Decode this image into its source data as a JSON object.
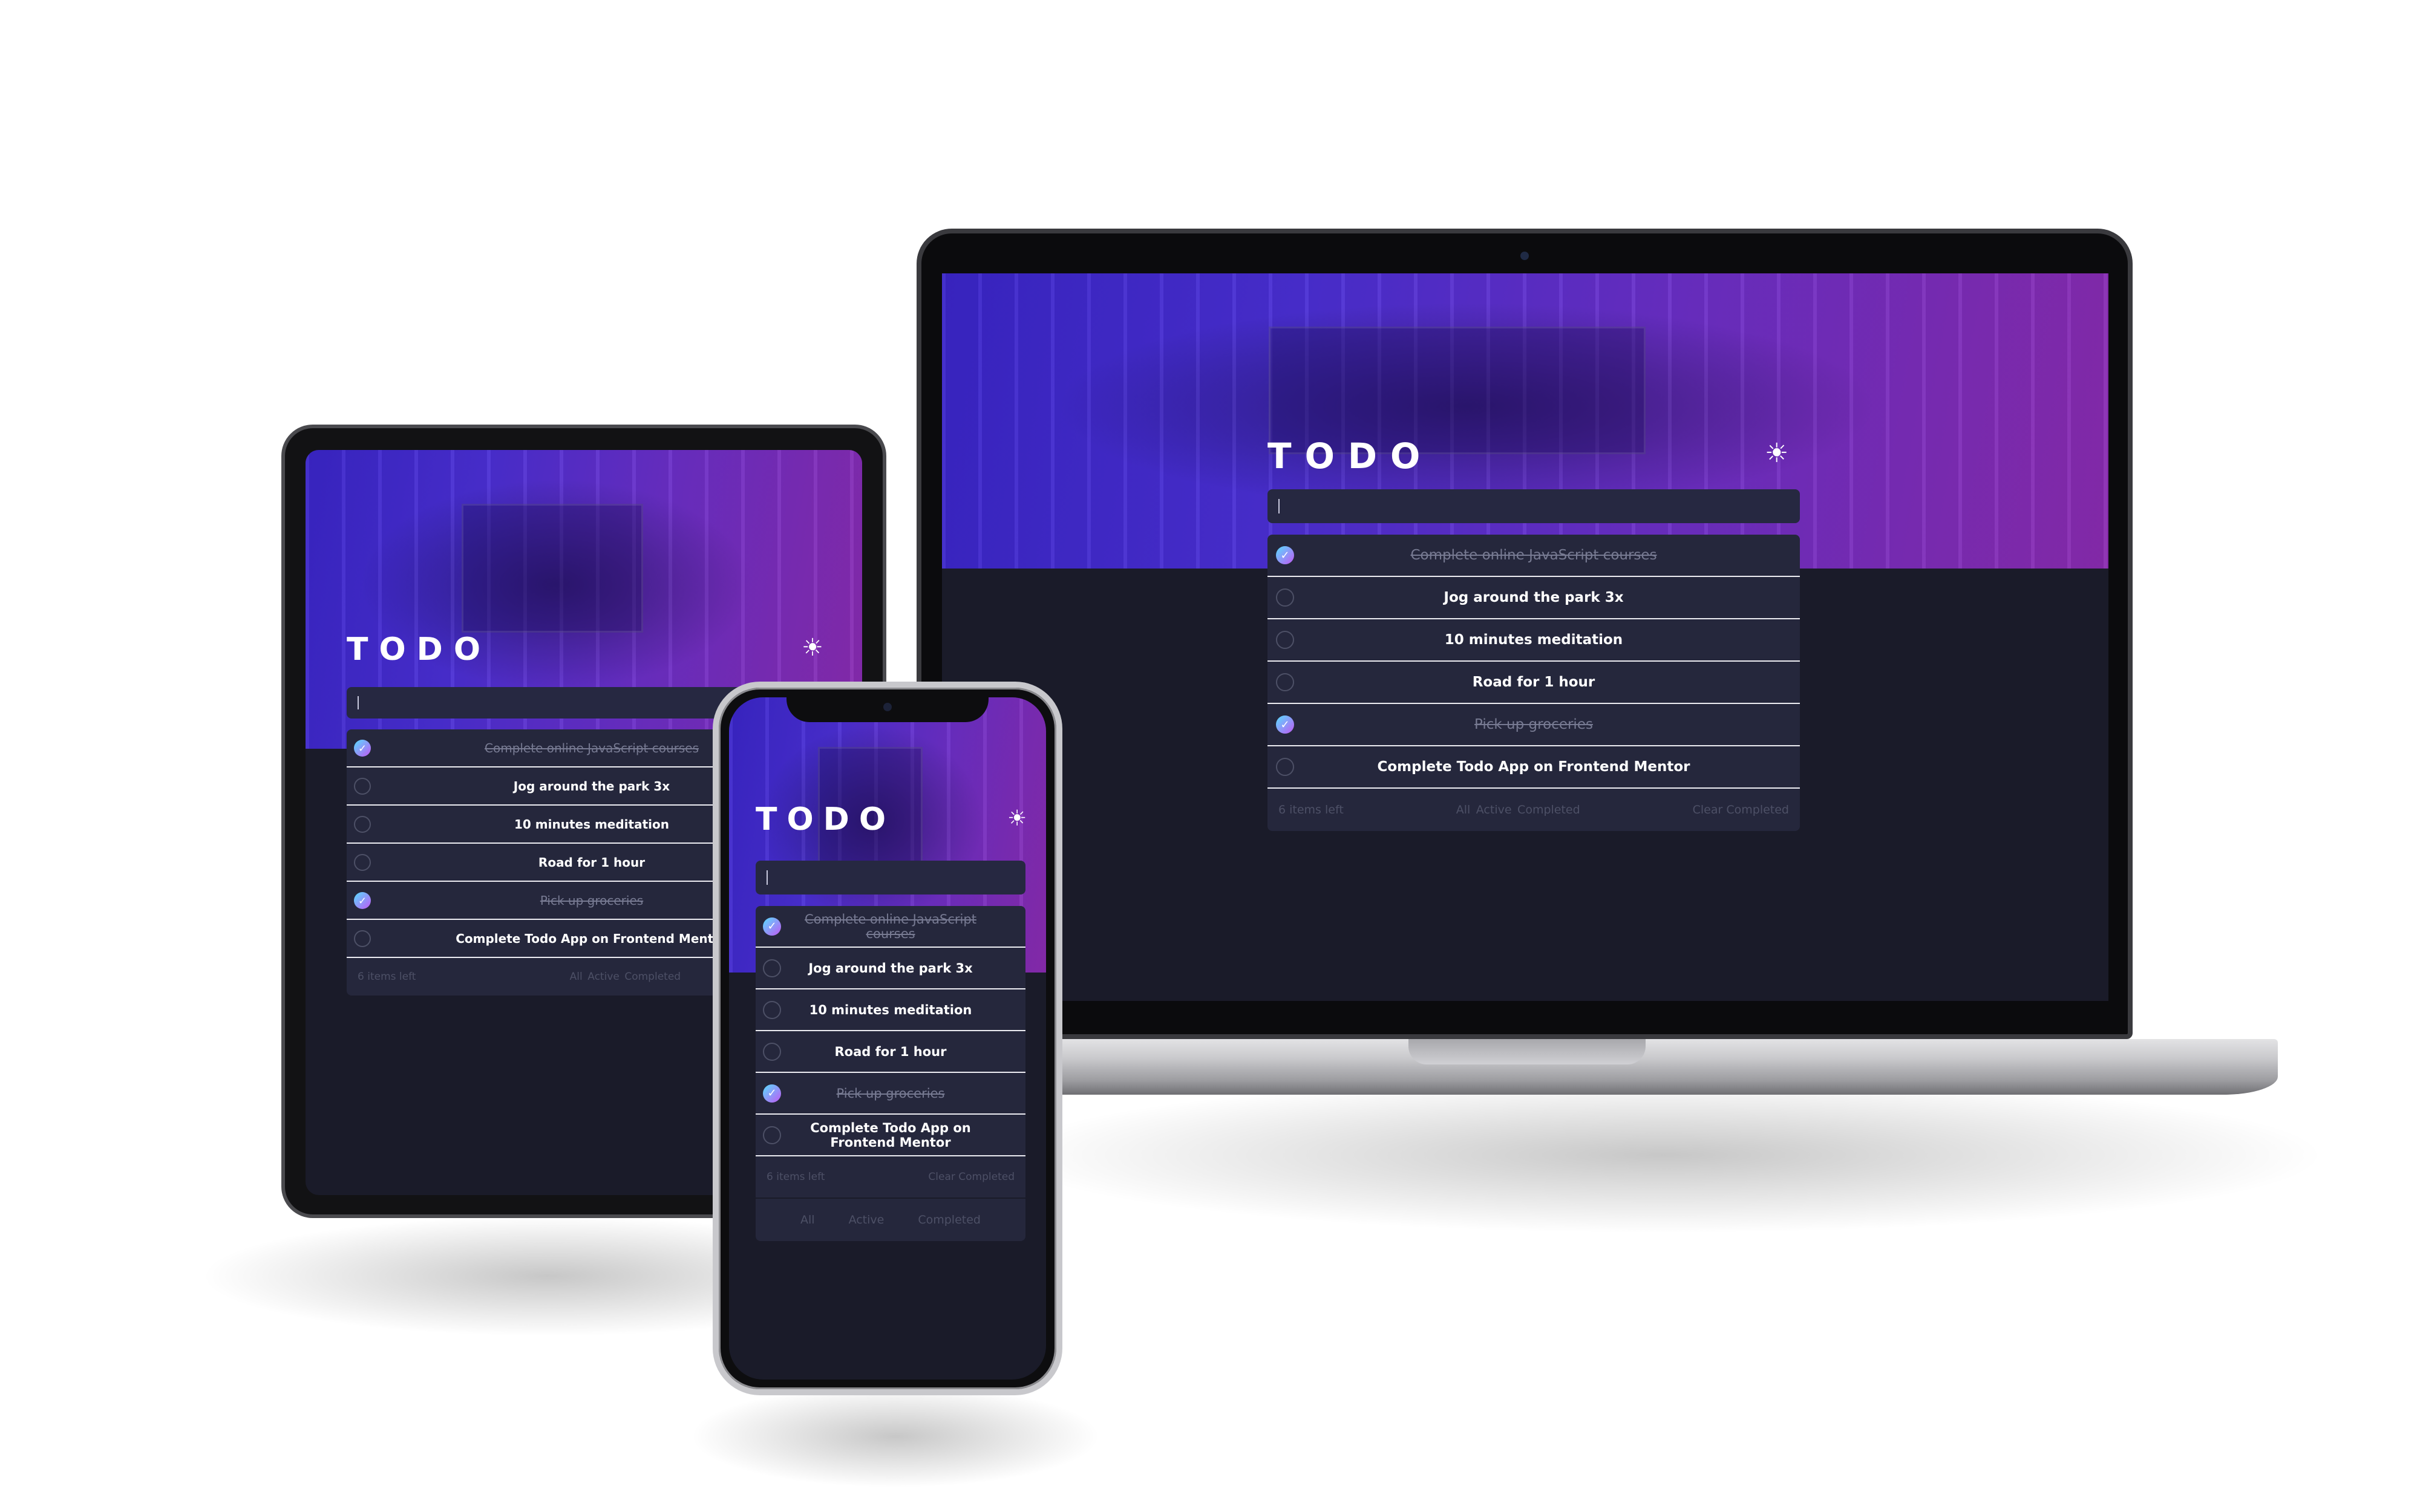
{
  "app": {
    "title": "TODO",
    "theme_icon": "☀",
    "input_value": "|",
    "todos": [
      {
        "text": "Complete online JavaScript courses",
        "completed": true
      },
      {
        "text": "Jog around the park 3x",
        "completed": false
      },
      {
        "text": "10 minutes meditation",
        "completed": false
      },
      {
        "text": "Road for 1 hour",
        "completed": false
      },
      {
        "text": "Pick up groceries",
        "completed": true
      },
      {
        "text": "Complete Todo App on Frontend Mentor",
        "completed": false
      }
    ],
    "items_left": "6 items left",
    "filters": {
      "all": "All",
      "active": "Active",
      "completed": "Completed"
    },
    "clear_completed": "Clear Completed",
    "check_glyph": "✓"
  },
  "colors": {
    "accent_gradient_start": "#57ddff",
    "accent_gradient_end": "#c058f3",
    "dark_background": "#1a1b29",
    "card": "#25273c",
    "muted_text": "#4d5066"
  }
}
